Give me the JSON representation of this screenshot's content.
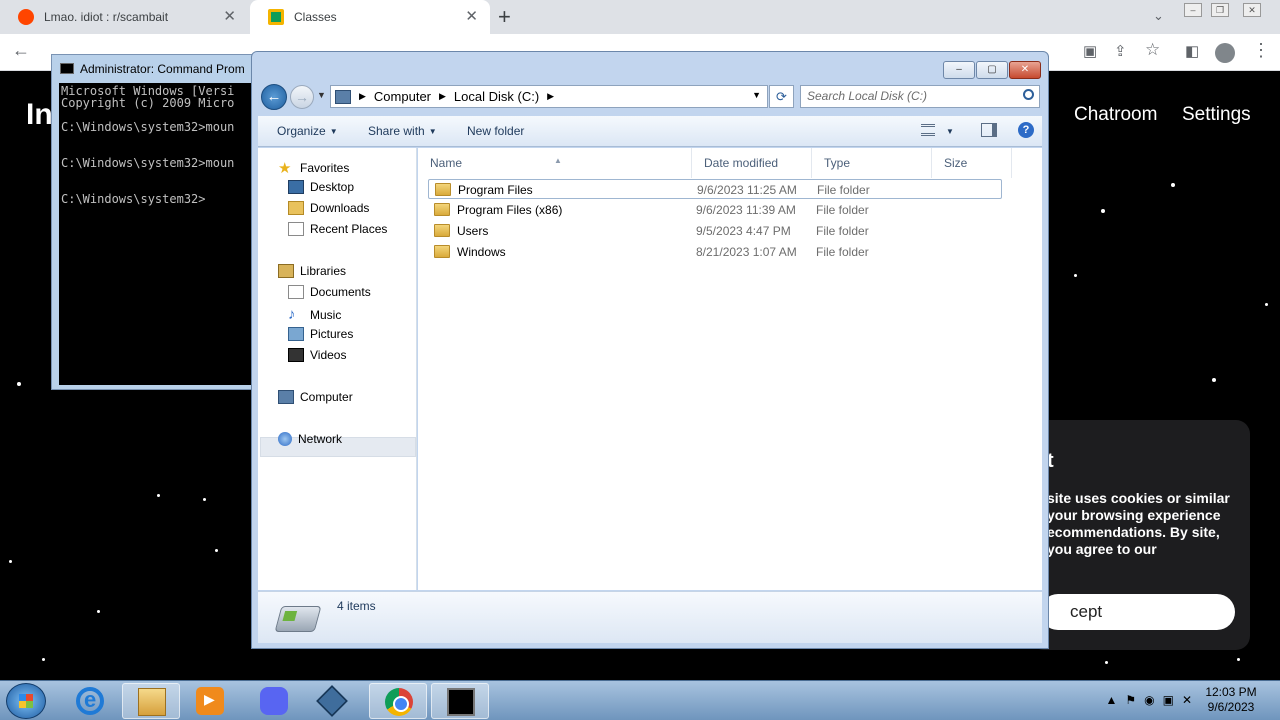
{
  "browser": {
    "tabs": [
      {
        "title": "Lmao. idiot : r/scambait",
        "active": false
      },
      {
        "title": "Classes",
        "active": true
      }
    ],
    "new_tab_symbol": "+",
    "close_symbol": "✕"
  },
  "webpage": {
    "logo": "In",
    "nav": [
      "Chatroom",
      "Settings"
    ],
    "cookie": {
      "title": "t",
      "text": "site uses cookies or similar your browsing experience ecommendations. By site, you agree to our",
      "button": "cept"
    }
  },
  "cmd": {
    "title": "Administrator: Command Prom",
    "lines": [
      "Microsoft Windows [Versi",
      "Copyright (c) 2009 Micro",
      "",
      "C:\\Windows\\system32>moun",
      "",
      "",
      "C:\\Windows\\system32>moun",
      "",
      "",
      "C:\\Windows\\system32>"
    ]
  },
  "explorer": {
    "address": [
      "Computer",
      "Local Disk (C:)"
    ],
    "search_placeholder": "Search Local Disk (C:)",
    "toolbar": {
      "organize": "Organize",
      "share_with": "Share with",
      "new_folder": "New folder"
    },
    "nav": {
      "favorites": "Favorites",
      "desktop": "Desktop",
      "downloads": "Downloads",
      "recent": "Recent Places",
      "libraries": "Libraries",
      "documents": "Documents",
      "music": "Music",
      "pictures": "Pictures",
      "videos": "Videos",
      "computer": "Computer",
      "network": "Network"
    },
    "columns": {
      "name": "Name",
      "date": "Date modified",
      "type": "Type",
      "size": "Size"
    },
    "rows": [
      {
        "name": "Program Files",
        "date": "9/6/2023 11:25 AM",
        "type": "File folder"
      },
      {
        "name": "Program Files (x86)",
        "date": "9/6/2023 11:39 AM",
        "type": "File folder"
      },
      {
        "name": "Users",
        "date": "9/5/2023 4:47 PM",
        "type": "File folder"
      },
      {
        "name": "Windows",
        "date": "8/21/2023 1:07 AM",
        "type": "File folder"
      }
    ],
    "item_count": "4 items"
  },
  "taskbar": {
    "apps": [
      "internet-explorer",
      "windows-explorer",
      "media-player",
      "discord",
      "virtualbox",
      "chrome",
      "command-prompt"
    ],
    "clock_time": "12:03 PM",
    "clock_date": "9/6/2023"
  }
}
